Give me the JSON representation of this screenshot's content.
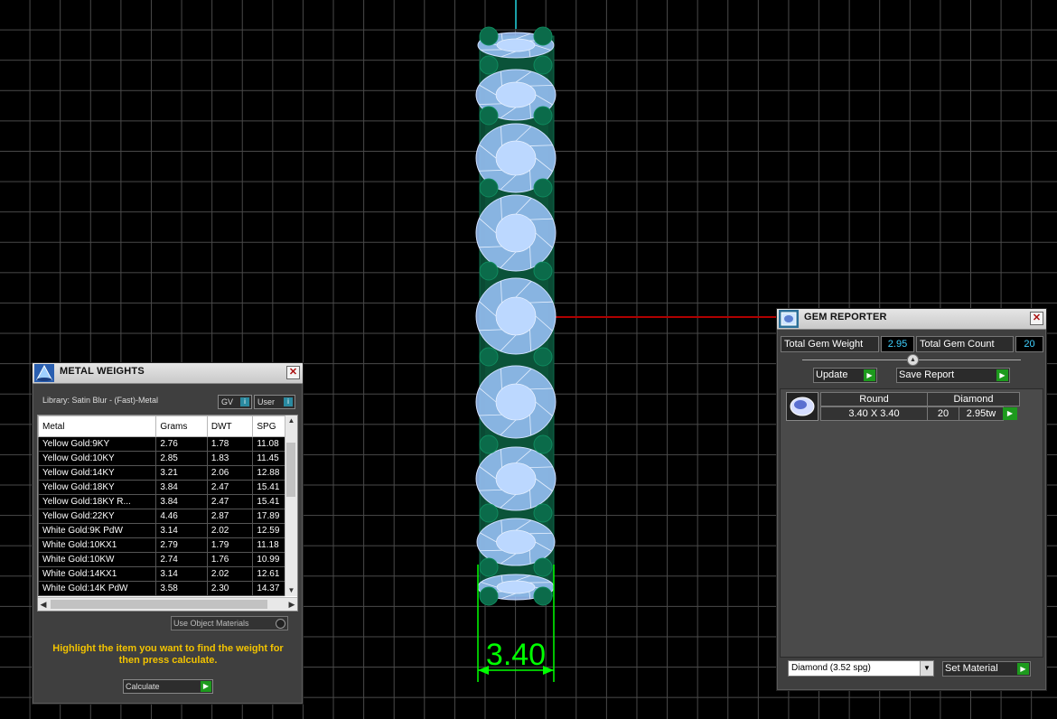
{
  "viewport": {
    "dimension_label": "3.40",
    "colors": {
      "grid": "#4a4a4a",
      "gem": "#9fc6ff",
      "prong": "#0b6b4a",
      "dimension": "#00ff00",
      "axis_red": "#b00000",
      "axis_cyan": "#1aa0a8"
    }
  },
  "metal_weights": {
    "title": "METAL WEIGHTS",
    "close": "✕",
    "library_label": "Library: Satin Blur - (Fast)-Metal",
    "gv_label": "GV",
    "user_label": "User",
    "columns": [
      "Metal",
      "Grams",
      "DWT",
      "SPG"
    ],
    "rows": [
      [
        "Yellow Gold:9KY",
        "2.76",
        "1.78",
        "11.08"
      ],
      [
        "Yellow Gold:10KY",
        "2.85",
        "1.83",
        "11.45"
      ],
      [
        "Yellow Gold:14KY",
        "3.21",
        "2.06",
        "12.88"
      ],
      [
        "Yellow Gold:18KY",
        "3.84",
        "2.47",
        "15.41"
      ],
      [
        "Yellow Gold:18KY R...",
        "3.84",
        "2.47",
        "15.41"
      ],
      [
        "Yellow Gold:22KY",
        "4.46",
        "2.87",
        "17.89"
      ],
      [
        "White Gold:9K PdW",
        "3.14",
        "2.02",
        "12.59"
      ],
      [
        "White Gold:10KX1",
        "2.79",
        "1.79",
        "11.18"
      ],
      [
        "White Gold:10KW",
        "2.74",
        "1.76",
        "10.99"
      ],
      [
        "White Gold:14KX1",
        "3.14",
        "2.02",
        "12.61"
      ],
      [
        "White Gold:14K PdW",
        "3.58",
        "2.30",
        "14.37"
      ]
    ],
    "use_object_materials": "Use Object Materials",
    "hint": "Highlight the item you want to find the weight for then press calculate.",
    "calculate": "Calculate"
  },
  "gem_reporter": {
    "title": "GEM REPORTER",
    "close": "✕",
    "total_weight_label": "Total Gem Weight",
    "total_weight_value": "2.95",
    "total_count_label": "Total Gem Count",
    "total_count_value": "20",
    "update": "Update",
    "save_report": "Save Report",
    "gem": {
      "shape": "Round",
      "material": "Diamond",
      "size": "3.40 X 3.40",
      "count": "20",
      "weight": "2.95tw"
    },
    "material_select": "Diamond     (3.52 spg)",
    "set_material": "Set Material"
  }
}
